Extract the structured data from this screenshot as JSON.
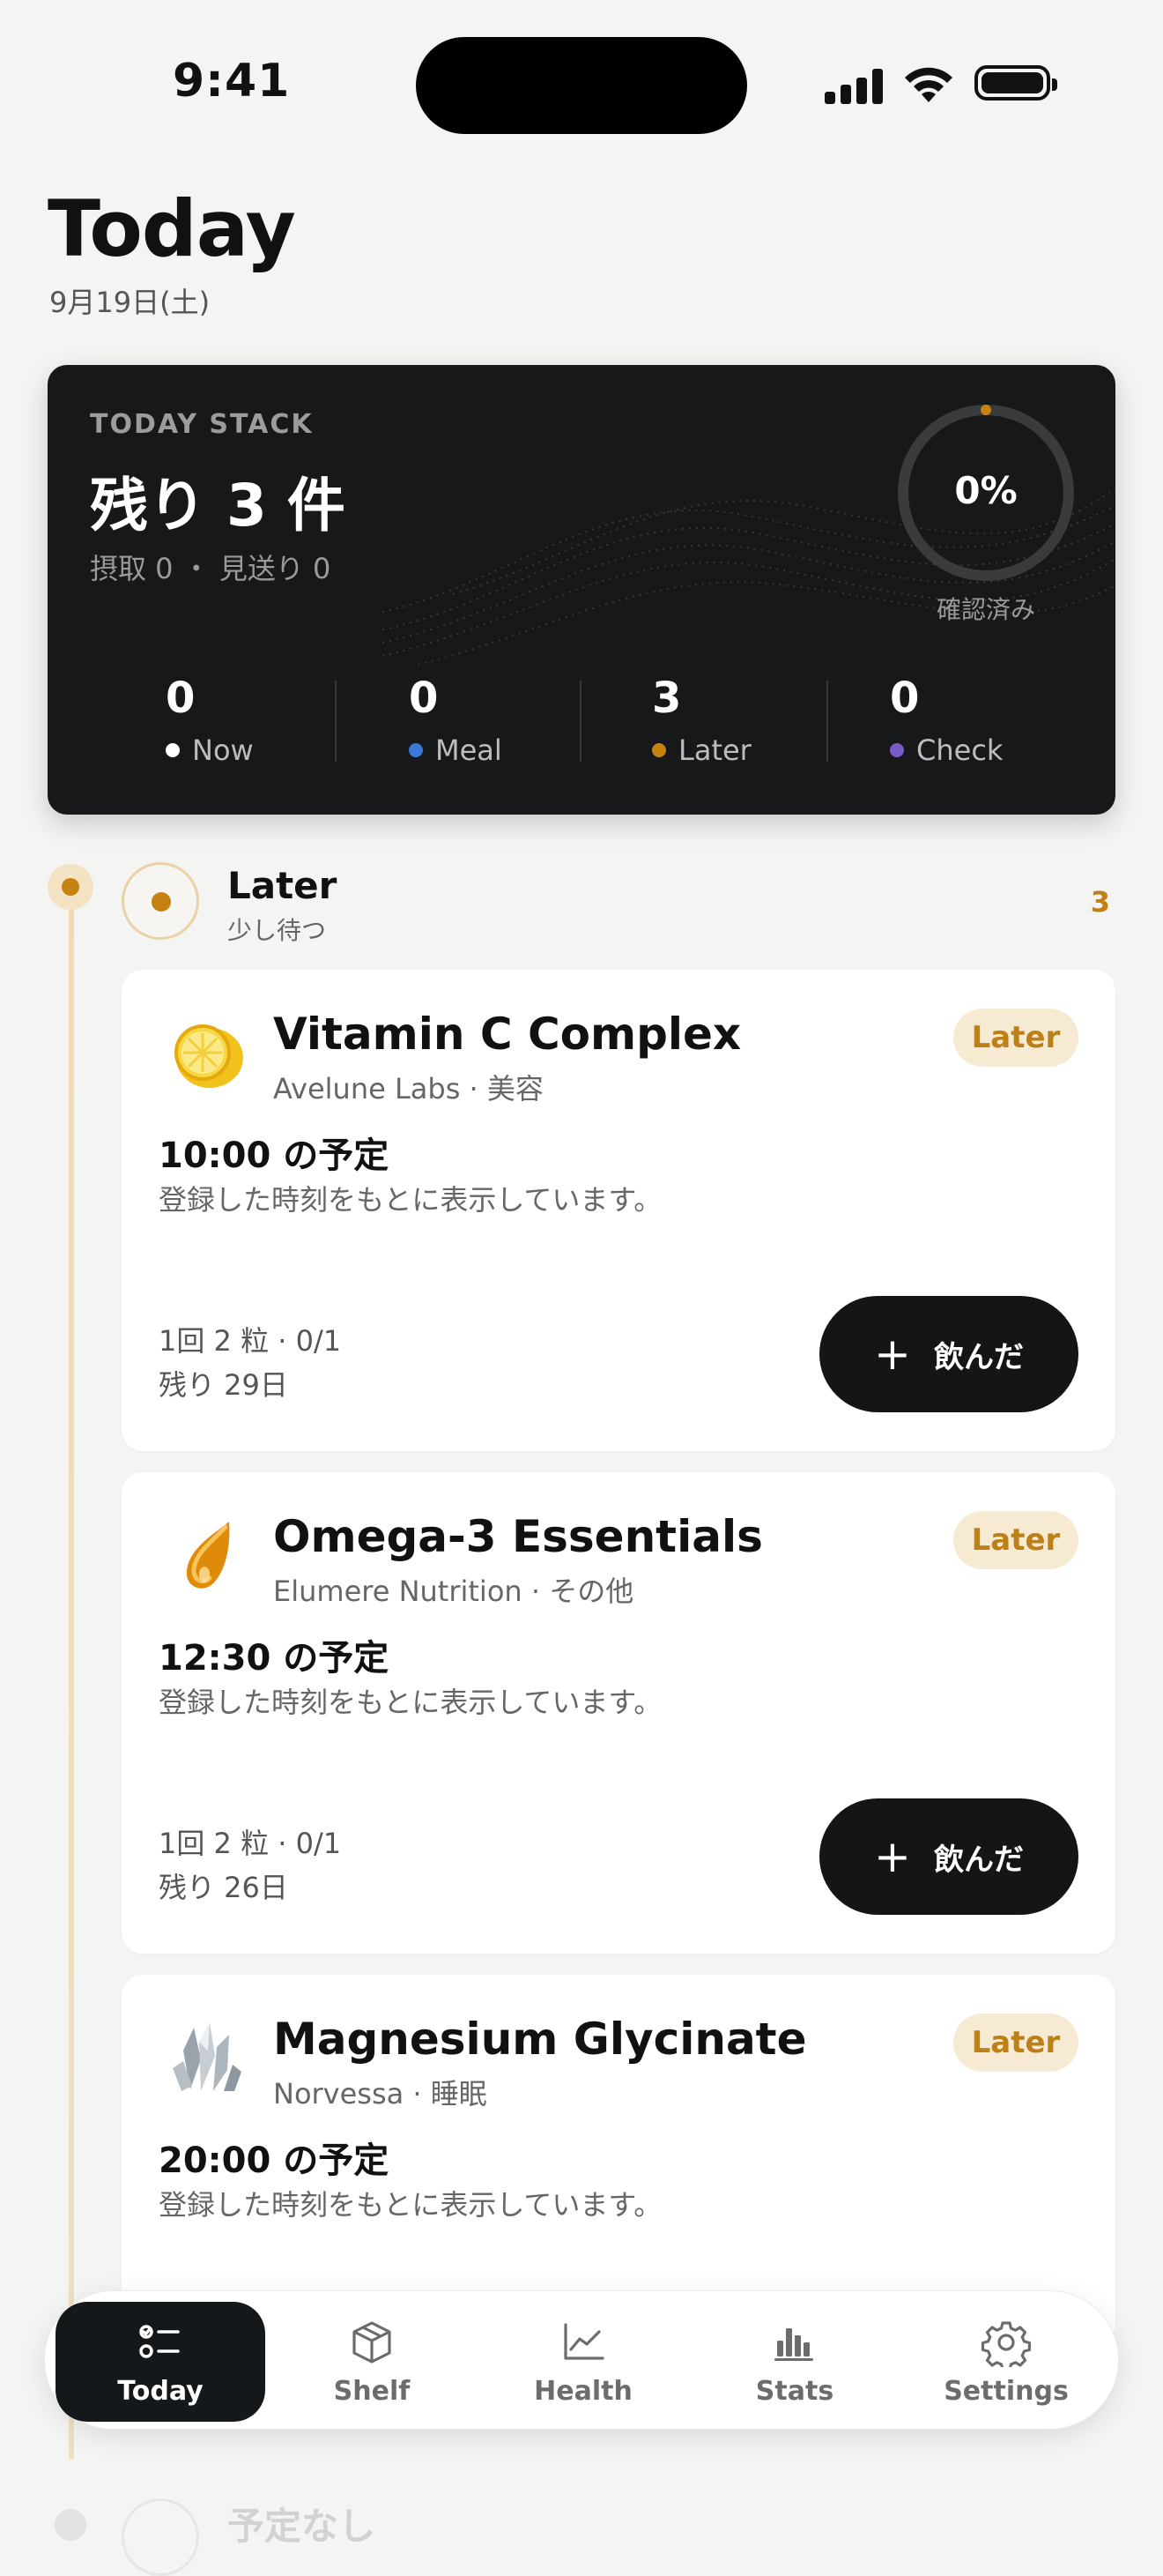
{
  "status_bar": {
    "time": "9:41"
  },
  "header": {
    "title": "Today",
    "date": "9月19日(土)"
  },
  "stack": {
    "label": "TODAY STACK",
    "remaining": "残り 3 件",
    "summary": "摂取 0 ・ 見送り 0",
    "progress_text": "0%",
    "progress": 0,
    "progress_label": "確認済み",
    "stats": [
      {
        "value": "0",
        "label": "Now",
        "color": "#ffffff"
      },
      {
        "value": "0",
        "label": "Meal",
        "color": "#3b7ad9"
      },
      {
        "value": "3",
        "label": "Later",
        "color": "#c58412"
      },
      {
        "value": "0",
        "label": "Check",
        "color": "#7a5cc9"
      }
    ]
  },
  "section": {
    "title": "Later",
    "subtitle": "少し待つ",
    "count": "3"
  },
  "cards": [
    {
      "icon": "lemon-icon",
      "name": "Vitamin C Complex",
      "brand": "Avelune Labs · 美容",
      "badge": "Later",
      "schedule": "10:00 の予定",
      "note": "登録した時刻をもとに表示しています。",
      "dose_line1": "1回 2 粒 · 0/1",
      "dose_line2": "残り 29日",
      "action": "飲んだ"
    },
    {
      "icon": "oil-drop-icon",
      "name": "Omega-3 Essentials",
      "brand": "Elumere Nutrition · その他",
      "badge": "Later",
      "schedule": "12:30 の予定",
      "note": "登録した時刻をもとに表示しています。",
      "dose_line1": "1回 2 粒 · 0/1",
      "dose_line2": "残り 26日",
      "action": "飲んだ"
    },
    {
      "icon": "crystal-icon",
      "name": "Magnesium Glycinate",
      "brand": "Norvessa · 睡眠",
      "badge": "Later",
      "schedule": "20:00 の予定",
      "note": "登録した時刻をもとに表示しています。"
    }
  ],
  "next_section": {
    "title": "予定なし"
  },
  "tabbar": {
    "items": [
      {
        "label": "Today",
        "icon": "checklist-icon",
        "active": true
      },
      {
        "label": "Shelf",
        "icon": "box-icon",
        "active": false
      },
      {
        "label": "Health",
        "icon": "line-chart-icon",
        "active": false
      },
      {
        "label": "Stats",
        "icon": "bar-chart-icon",
        "active": false
      },
      {
        "label": "Settings",
        "icon": "gear-icon",
        "active": false
      }
    ]
  }
}
